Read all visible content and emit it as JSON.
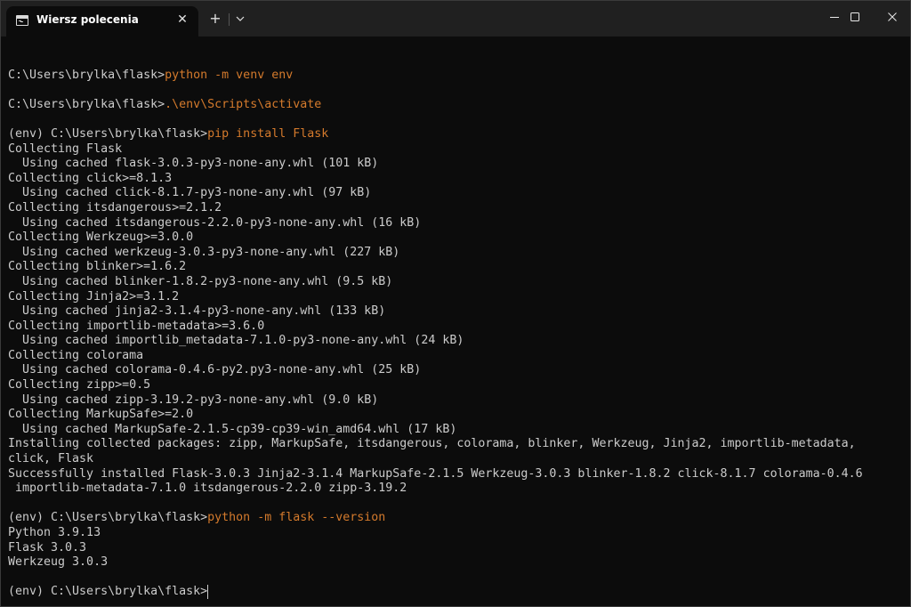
{
  "window": {
    "tab_title": "Wiersz polecenia",
    "tab_close_glyph": "✕",
    "new_tab_glyph": "+"
  },
  "terminal": {
    "lines": [
      {
        "prompt": "",
        "text": ""
      },
      {
        "prompt": "C:\\Users\\brylka\\flask>",
        "cmd": "python -m venv env"
      },
      {
        "prompt": "",
        "text": ""
      },
      {
        "prompt": "C:\\Users\\brylka\\flask>",
        "cmd": ".\\env\\Scripts\\activate"
      },
      {
        "prompt": "",
        "text": ""
      },
      {
        "prompt": "(env) C:\\Users\\brylka\\flask>",
        "cmd": "pip install Flask"
      },
      {
        "text": "Collecting Flask"
      },
      {
        "text": "  Using cached flask-3.0.3-py3-none-any.whl (101 kB)"
      },
      {
        "text": "Collecting click>=8.1.3"
      },
      {
        "text": "  Using cached click-8.1.7-py3-none-any.whl (97 kB)"
      },
      {
        "text": "Collecting itsdangerous>=2.1.2"
      },
      {
        "text": "  Using cached itsdangerous-2.2.0-py3-none-any.whl (16 kB)"
      },
      {
        "text": "Collecting Werkzeug>=3.0.0"
      },
      {
        "text": "  Using cached werkzeug-3.0.3-py3-none-any.whl (227 kB)"
      },
      {
        "text": "Collecting blinker>=1.6.2"
      },
      {
        "text": "  Using cached blinker-1.8.2-py3-none-any.whl (9.5 kB)"
      },
      {
        "text": "Collecting Jinja2>=3.1.2"
      },
      {
        "text": "  Using cached jinja2-3.1.4-py3-none-any.whl (133 kB)"
      },
      {
        "text": "Collecting importlib-metadata>=3.6.0"
      },
      {
        "text": "  Using cached importlib_metadata-7.1.0-py3-none-any.whl (24 kB)"
      },
      {
        "text": "Collecting colorama"
      },
      {
        "text": "  Using cached colorama-0.4.6-py2.py3-none-any.whl (25 kB)"
      },
      {
        "text": "Collecting zipp>=0.5"
      },
      {
        "text": "  Using cached zipp-3.19.2-py3-none-any.whl (9.0 kB)"
      },
      {
        "text": "Collecting MarkupSafe>=2.0"
      },
      {
        "text": "  Using cached MarkupSafe-2.1.5-cp39-cp39-win_amd64.whl (17 kB)"
      },
      {
        "text": "Installing collected packages: zipp, MarkupSafe, itsdangerous, colorama, blinker, Werkzeug, Jinja2, importlib-metadata,"
      },
      {
        "text": "click, Flask"
      },
      {
        "text": "Successfully installed Flask-3.0.3 Jinja2-3.1.4 MarkupSafe-2.1.5 Werkzeug-3.0.3 blinker-1.8.2 click-8.1.7 colorama-0.4.6"
      },
      {
        "text": " importlib-metadata-7.1.0 itsdangerous-2.2.0 zipp-3.19.2"
      },
      {
        "text": ""
      },
      {
        "prompt": "(env) C:\\Users\\brylka\\flask>",
        "cmd": "python -m flask --version"
      },
      {
        "text": "Python 3.9.13"
      },
      {
        "text": "Flask 3.0.3"
      },
      {
        "text": "Werkzeug 3.0.3"
      },
      {
        "text": ""
      },
      {
        "prompt": "(env) C:\\Users\\brylka\\flask>",
        "cursor": true
      }
    ]
  }
}
